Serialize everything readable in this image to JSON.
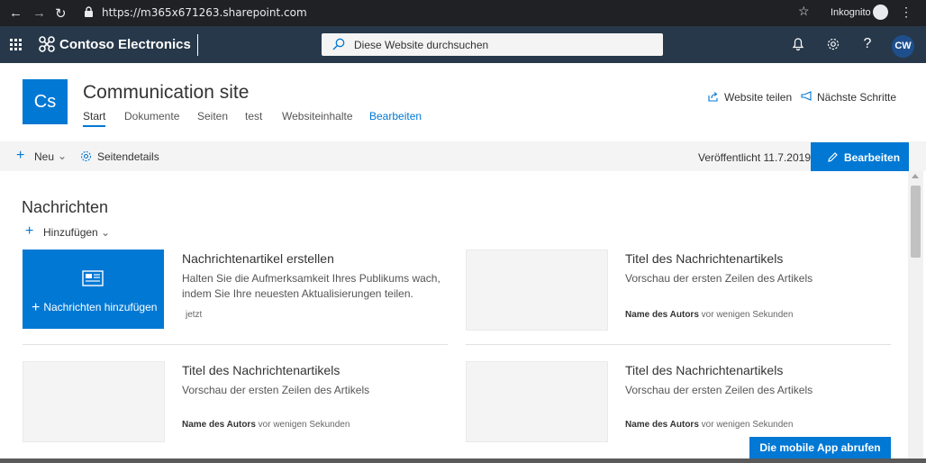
{
  "browser": {
    "url": "https://m365x671263.sharepoint.com",
    "incognito_label": "Inkognito",
    "avatar_initials": "CW"
  },
  "suite": {
    "brand_name": "Contoso Electronics",
    "search_placeholder": "Diese Website durchsuchen"
  },
  "site": {
    "logo_initials": "Cs",
    "title": "Communication site",
    "nav": [
      {
        "label": "Start"
      },
      {
        "label": "Dokumente"
      },
      {
        "label": "Seiten"
      },
      {
        "label": "test"
      },
      {
        "label": "Websiteinhalte"
      },
      {
        "label": "Bearbeiten"
      }
    ],
    "share_label": "Website teilen",
    "next_steps_label": "Nächste Schritte"
  },
  "commandbar": {
    "new_label": "Neu",
    "page_details_label": "Seitendetails",
    "published_label": "Veröffentlicht 11.7.2019",
    "edit_label": "Bearbeiten"
  },
  "news": {
    "section_title": "Nachrichten",
    "add_label": "Hinzufügen",
    "hero_label": "Nachrichten hinzufügen",
    "items": [
      {
        "title": "Nachrichtenartikel erstellen",
        "desc": "Halten Sie die Aufmerksamkeit Ihres Publikums wach, indem Sie Ihre neuesten Aktualisierungen teilen.",
        "author": "",
        "time": "jetzt"
      },
      {
        "title": "Titel des Nachrichtenartikels",
        "desc": "Vorschau der ersten Zeilen des Artikels",
        "author": "Name des Autors",
        "time": "vor wenigen Sekunden"
      },
      {
        "title": "Titel des Nachrichtenartikels",
        "desc": "Vorschau der ersten Zeilen des Artikels",
        "author": "Name des Autors",
        "time": "vor wenigen Sekunden"
      },
      {
        "title": "Titel des Nachrichtenartikels",
        "desc": "Vorschau der ersten Zeilen des Artikels",
        "author": "Name des Autors",
        "time": "vor wenigen Sekunden"
      }
    ]
  },
  "mobile_app_label": "Die mobile App abrufen",
  "colors": {
    "accent": "#0078d4",
    "suitebar": "#27384a",
    "browser_chrome": "#202124"
  }
}
